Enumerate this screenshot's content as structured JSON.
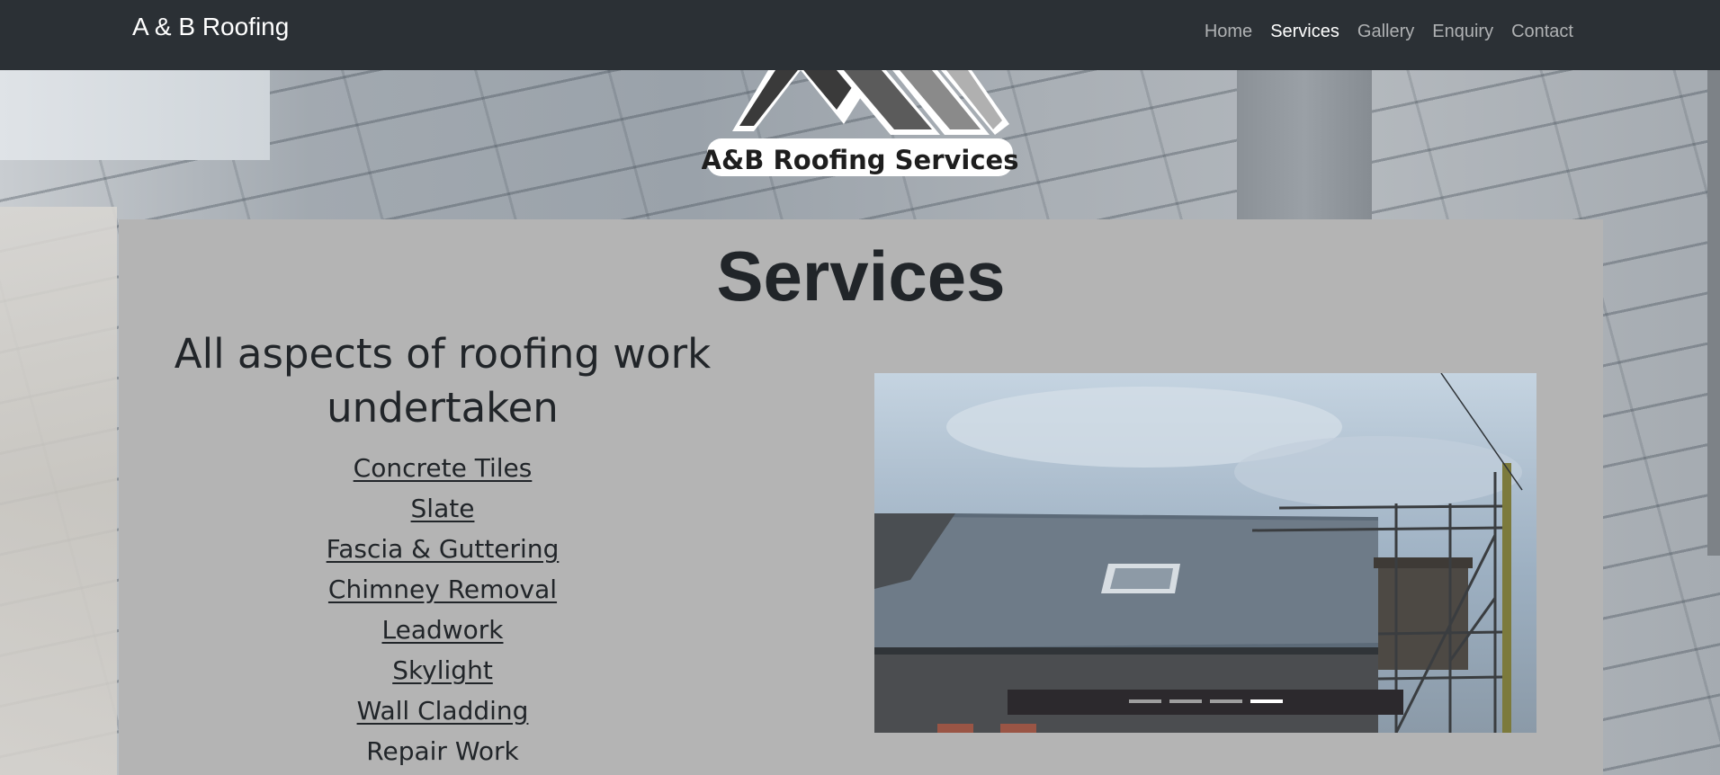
{
  "navbar": {
    "brand": "A & B Roofing",
    "links": [
      {
        "label": "Home",
        "active": false
      },
      {
        "label": "Services",
        "active": true
      },
      {
        "label": "Gallery",
        "active": false
      },
      {
        "label": "Enquiry",
        "active": false
      },
      {
        "label": "Contact",
        "active": false
      }
    ]
  },
  "logo": {
    "text": "A&B Roofing Services"
  },
  "main": {
    "title": "Services",
    "subtitle": "All aspects of roofing work undertaken",
    "services": [
      {
        "label": "Concrete Tiles",
        "link": true
      },
      {
        "label": "Slate",
        "link": true
      },
      {
        "label": "Fascia & Guttering",
        "link": true
      },
      {
        "label": "Chimney Removal",
        "link": true
      },
      {
        "label": "Leadwork",
        "link": true
      },
      {
        "label": "Skylight",
        "link": true
      },
      {
        "label": "Wall Cladding",
        "link": true
      },
      {
        "label": "Repair Work",
        "link": false
      }
    ]
  },
  "carousel": {
    "slide_count": 4,
    "active_index": 3
  },
  "colors": {
    "navbar": "#2b3035",
    "panel": "#b4b4b4",
    "text": "#212529"
  }
}
